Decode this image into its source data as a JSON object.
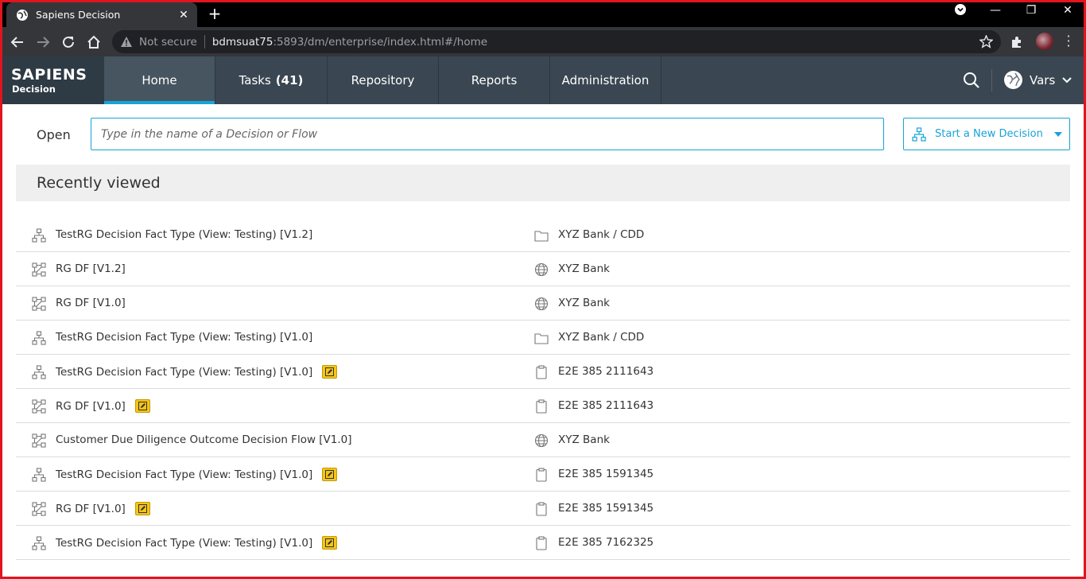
{
  "browser": {
    "tab_title": "Sapiens Decision",
    "not_secure": "Not secure",
    "url_host": "bdmsuat75",
    "url_rest": ":5893/dm/enterprise/index.html#/home"
  },
  "header": {
    "brand_name": "SAPIENS",
    "brand_sub": "Decision",
    "nav": {
      "home": "Home",
      "tasks": "Tasks",
      "tasks_count": "(41)",
      "repository": "Repository",
      "reports": "Reports",
      "administration": "Administration"
    },
    "user": "Vars",
    "accent_color": "#17a3d8"
  },
  "open": {
    "label": "Open",
    "placeholder": "Type in the name of a Decision or Flow",
    "new_decision": "Start a New Decision"
  },
  "recent": {
    "title": "Recently viewed",
    "items": [
      {
        "name": "TestRG Decision Fact Type (View: Testing) [V1.2]",
        "type": "decision-icon",
        "edit": false,
        "location": "XYZ Bank / CDD",
        "location_icon": "folder-icon"
      },
      {
        "name": "RG DF [V1.2]",
        "type": "flow-icon",
        "edit": false,
        "location": "XYZ Bank",
        "location_icon": "globe-icon"
      },
      {
        "name": "RG DF [V1.0]",
        "type": "flow-icon",
        "edit": false,
        "location": "XYZ Bank",
        "location_icon": "globe-icon"
      },
      {
        "name": "TestRG Decision Fact Type (View: Testing) [V1.0]",
        "type": "decision-icon",
        "edit": false,
        "location": "XYZ Bank / CDD",
        "location_icon": "folder-icon"
      },
      {
        "name": "TestRG Decision Fact Type (View: Testing) [V1.0]",
        "type": "decision-icon",
        "edit": true,
        "location": "E2E 385 2111643",
        "location_icon": "clipboard-icon"
      },
      {
        "name": "RG DF [V1.0]",
        "type": "flow-icon",
        "edit": true,
        "location": "E2E 385 2111643",
        "location_icon": "clipboard-icon"
      },
      {
        "name": "Customer Due Diligence Outcome Decision Flow [V1.0]",
        "type": "flow-icon",
        "edit": false,
        "location": "XYZ Bank",
        "location_icon": "globe-icon"
      },
      {
        "name": "TestRG Decision Fact Type (View: Testing) [V1.0]",
        "type": "decision-icon",
        "edit": true,
        "location": "E2E 385 1591345",
        "location_icon": "clipboard-icon"
      },
      {
        "name": "RG DF [V1.0]",
        "type": "flow-icon",
        "edit": true,
        "location": "E2E 385 1591345",
        "location_icon": "clipboard-icon"
      },
      {
        "name": "TestRG Decision Fact Type (View: Testing) [V1.0]",
        "type": "decision-icon",
        "edit": true,
        "location": "E2E 385 7162325",
        "location_icon": "clipboard-icon"
      }
    ]
  }
}
